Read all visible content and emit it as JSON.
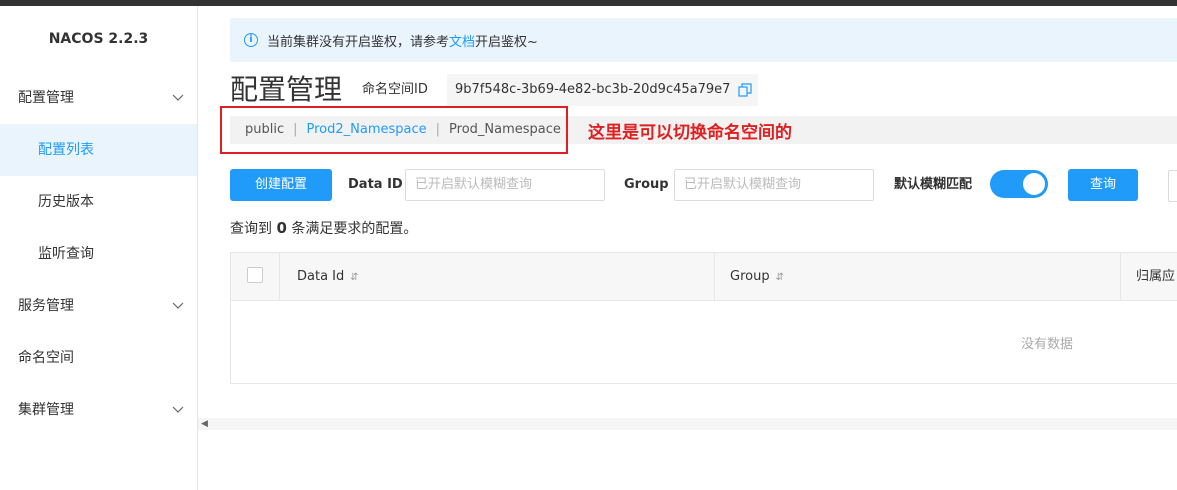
{
  "app": {
    "brand": "NACOS 2.2.3"
  },
  "sidebar": {
    "groups": [
      {
        "label": "配置管理",
        "icon": "chevron-down-icon"
      },
      {
        "label": "服务管理",
        "icon": "chevron-down-icon"
      },
      {
        "label": "命名空间"
      },
      {
        "label": "集群管理",
        "icon": "chevron-down-icon"
      }
    ],
    "config_items": [
      "配置列表",
      "历史版本",
      "监听查询"
    ]
  },
  "notice": {
    "prefix": "当前集群没有开启鉴权，请参考",
    "link": "文档",
    "suffix": "开启鉴权~"
  },
  "page": {
    "title": "配置管理",
    "namespace_label": "命名空间ID",
    "namespace_id": "9b7f548c-3b69-4e82-bc3b-20d9c45a79e7"
  },
  "namespaces": {
    "items": [
      "public",
      "Prod2_Namespace",
      "Prod_Namespace"
    ],
    "selected": "Prod2_Namespace"
  },
  "annotation": "这里是可以切换命名空间的",
  "filters": {
    "create_button": "创建配置",
    "data_id_label": "Data ID",
    "data_id_placeholder": "已开启默认模糊查询",
    "group_label": "Group",
    "group_placeholder": "已开启默认模糊查询",
    "fuzzy_label": "默认模糊匹配",
    "fuzzy_on": true,
    "query_button": "查询"
  },
  "result": {
    "prefix": "查询到",
    "count": "0",
    "suffix": "条满足要求的配置。"
  },
  "table": {
    "columns": [
      "Data Id",
      "Group",
      "归属应"
    ],
    "sort_icon": "sort-icon",
    "empty_text": "没有数据"
  },
  "colors": {
    "accent": "#209bfa",
    "annotation": "#e02020"
  }
}
